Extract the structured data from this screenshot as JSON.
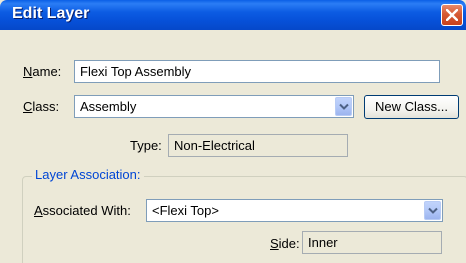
{
  "window": {
    "title": "Edit Layer"
  },
  "form": {
    "name_label_underlined": "N",
    "name_label_rest": "ame:",
    "name_value": "Flexi Top Assembly",
    "class_label_underlined": "C",
    "class_label_rest": "lass:",
    "class_value": "Assembly",
    "new_class_button": "New Class...",
    "type_label": "Type:",
    "type_value": "Non-Electrical"
  },
  "layer_association": {
    "legend": "Layer Association:",
    "associated_label_underlined": "A",
    "associated_label_rest": "ssociated With:",
    "associated_value": "<Flexi Top>",
    "side_label_underlined": "S",
    "side_label_rest": "ide:",
    "side_value": "Inner"
  },
  "icons": {
    "close": "close-icon",
    "dropdown": "chevron-down-icon"
  },
  "colors": {
    "titlebar": "#0a5fe6",
    "close_button": "#d65a34",
    "dialog_background": "#ece9d8",
    "groupbox_legend": "#0046d5",
    "input_border": "#7f9db9"
  }
}
